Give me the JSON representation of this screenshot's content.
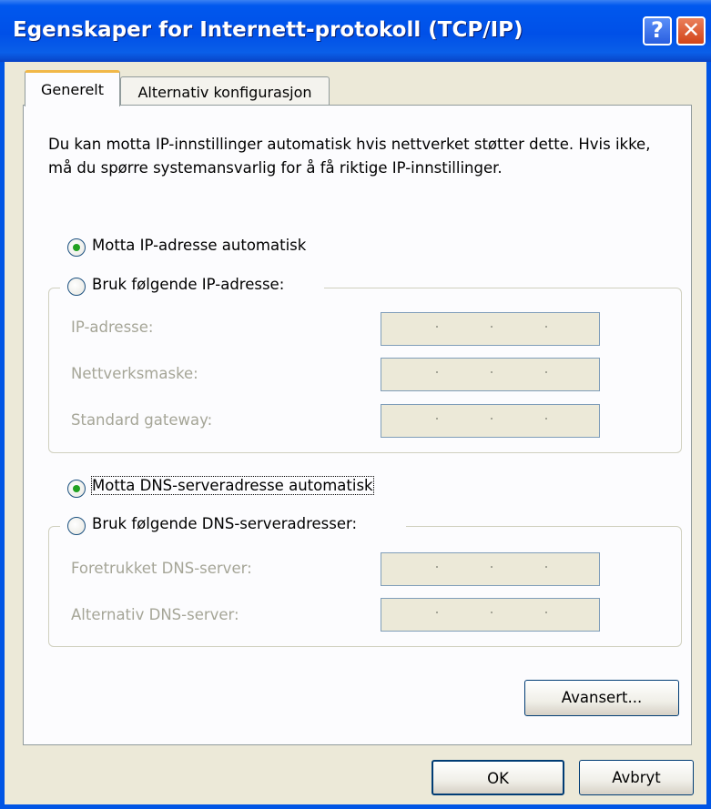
{
  "window": {
    "title": "Egenskaper for Internett-protokoll (TCP/IP)",
    "help_glyph": "?",
    "close_glyph": "✕"
  },
  "tabs": [
    {
      "label": "Generelt",
      "active": true
    },
    {
      "label": "Alternativ konfigurasjon",
      "active": false
    }
  ],
  "description": "Du kan motta IP-innstillinger automatisk hvis nettverket støtter dette. Hvis ikke, må du spørre systemansvarlig for å få riktige IP-innstillinger.",
  "ip_section": {
    "auto_label": "Motta IP-adresse automatisk",
    "auto_selected": true,
    "manual_label": "Bruk følgende IP-adresse:",
    "manual_selected": false,
    "fields": [
      {
        "label": "IP-adresse:"
      },
      {
        "label": "Nettverksmaske:"
      },
      {
        "label": "Standard gateway:"
      }
    ]
  },
  "dns_section": {
    "auto_label": "Motta DNS-serveradresse automatisk",
    "auto_selected": true,
    "manual_label": "Bruk følgende DNS-serveradresser:",
    "manual_selected": false,
    "fields": [
      {
        "label": "Foretrukket DNS-server:"
      },
      {
        "label": "Alternativ DNS-server:"
      }
    ]
  },
  "buttons": {
    "advanced": "Avansert...",
    "ok": "OK",
    "cancel": "Avbryt"
  },
  "colors": {
    "title_bar": "#0058ee",
    "dialog_bg": "#ece9d8",
    "radio_check": "#21a121",
    "disabled_text": "#a5a597"
  }
}
